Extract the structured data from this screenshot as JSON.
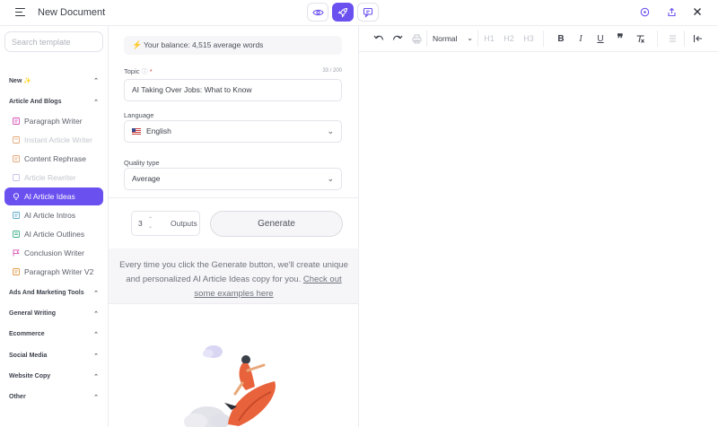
{
  "header": {
    "title": "New Document"
  },
  "sidebar": {
    "search_placeholder": "Search template",
    "categories": [
      {
        "label": "New ✨"
      },
      {
        "label": "Article And Blogs"
      },
      {
        "label": "Ads And Marketing Tools"
      },
      {
        "label": "General Writing"
      },
      {
        "label": "Ecommerce"
      },
      {
        "label": "Social Media"
      },
      {
        "label": "Website Copy"
      },
      {
        "label": "Other"
      }
    ],
    "items": [
      {
        "label": "Paragraph Writer",
        "color": "#d64fb5"
      },
      {
        "label": "Instant Article Writer",
        "color": "#e6a77a"
      },
      {
        "label": "Content Rephrase",
        "color": "#e6a77a"
      },
      {
        "label": "Article Rewriter",
        "color": "#c9c0ee"
      },
      {
        "label": "AI Article Ideas",
        "color": "#ffffff"
      },
      {
        "label": "AI Article Intros",
        "color": "#5ba8c9"
      },
      {
        "label": "AI Article Outlines",
        "color": "#3fae8a"
      },
      {
        "label": "Conclusion Writer",
        "color": "#d64fb5"
      },
      {
        "label": "Paragraph Writer V2",
        "color": "#e09a4a"
      }
    ]
  },
  "form": {
    "balance": "Your balance: 4,515 average words",
    "topic_label": "Topic",
    "topic_required": "*",
    "topic_counter": "33 / 200",
    "topic_value": "AI Taking Over Jobs: What to Know",
    "language_label": "Language",
    "language_value": "English",
    "quality_label": "Quality type",
    "quality_value": "Average",
    "outputs_value": "3",
    "outputs_label": "Outputs",
    "generate_label": "Generate",
    "info_text": "Every time you click the Generate button, we'll create unique and personalized AI Article Ideas copy for you.",
    "info_link": "Check out some examples here"
  },
  "editor": {
    "style_value": "Normal",
    "h1": "H1",
    "h2": "H2",
    "h3": "H3"
  },
  "colors": {
    "accent": "#6b50f0"
  }
}
